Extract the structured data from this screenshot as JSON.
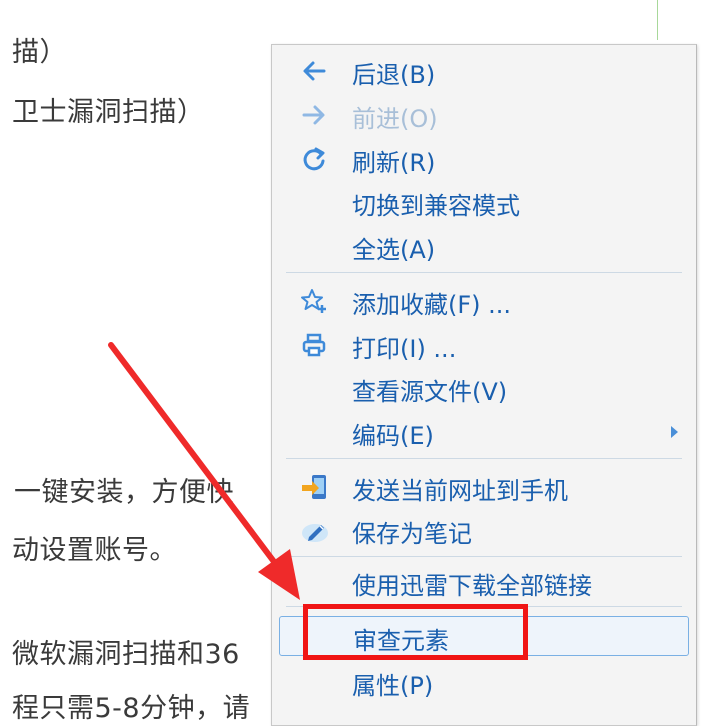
{
  "page": {
    "lines": [
      "描）",
      "卫士漏洞扫描）",
      "一键安装，方便快",
      "动设置账号。",
      "微软漏洞扫描和36",
      "程只需5-8分钟，请"
    ]
  },
  "menu": {
    "items": [
      {
        "label": "后退(B)",
        "icon": "back-arrow-icon"
      },
      {
        "label": "前进(O)",
        "icon": "forward-arrow-icon"
      },
      {
        "label": "刷新(R)",
        "icon": "refresh-icon"
      },
      {
        "label": "切换到兼容模式"
      },
      {
        "label": "全选(A)"
      },
      {
        "label": "添加收藏(F) ...",
        "icon": "add-favorite-star-icon"
      },
      {
        "label": "打印(I) ...",
        "icon": "printer-icon"
      },
      {
        "label": "查看源文件(V)"
      },
      {
        "label": "编码(E)"
      },
      {
        "label": "发送当前网址到手机",
        "icon": "send-to-phone-icon"
      },
      {
        "label": "保存为笔记",
        "icon": "note-icon"
      },
      {
        "label": "使用迅雷下载全部链接"
      },
      {
        "label": "审查元素"
      },
      {
        "label": "属性(P)"
      }
    ]
  },
  "colors": {
    "menu_text": "#1a5fae",
    "highlight_annotation": "#f01515"
  }
}
